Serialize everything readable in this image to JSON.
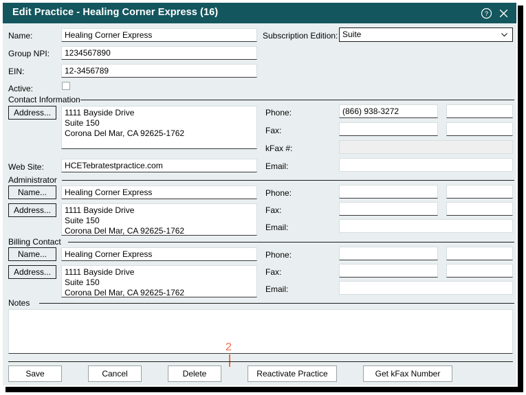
{
  "window": {
    "title": "Edit Practice - Healing Corner Express (16)",
    "help_icon": "help-circle-icon",
    "close_icon": "close-icon",
    "titlebar_color": "#14565e",
    "body_color": "#e9eff0"
  },
  "top": {
    "name_label": "Name:",
    "name_value": "Healing Corner Express",
    "group_npi_label": "Group NPI:",
    "group_npi_value": "1234567890",
    "ein_label": "EIN:",
    "ein_value": "12-3456789",
    "active_label": "Active:",
    "active_checked": false,
    "edition_label": "Subscription Edition:",
    "edition_value": "Suite",
    "edition_caret_icon": "chevron-down-icon"
  },
  "contact": {
    "group_caption": "Contact Information",
    "address_button": "Address...",
    "address_value": "1111 Bayside Drive\nSuite 150\nCorona Del Mar, CA 92625-1762",
    "website_label": "Web Site:",
    "website_value": "HCETebratestpractice.com",
    "phone_label": "Phone:",
    "phone_value": "(866) 938-3272",
    "phone_ext_value": "",
    "fax_label": "Fax:",
    "fax_value": "",
    "fax_ext_value": "",
    "kfax_label": "kFax #:",
    "kfax_value": "",
    "email_label": "Email:",
    "email_value": ""
  },
  "administrator": {
    "group_caption": "Administrator",
    "name_button": "Name...",
    "name_value": "Healing Corner Express",
    "address_button": "Address...",
    "address_value": "1111 Bayside Drive\nSuite 150\nCorona Del Mar, CA 92625-1762",
    "phone_label": "Phone:",
    "phone_value": "",
    "phone_ext_value": "",
    "fax_label": "Fax:",
    "fax_value": "",
    "fax_ext_value": "",
    "email_label": "Email:",
    "email_value": ""
  },
  "billing": {
    "group_caption": "Billing Contact",
    "name_button": "Name...",
    "name_value": "Healing Corner Express",
    "address_button": "Address...",
    "address_value": "1111 Bayside Drive\nSuite 150\nCorona Del Mar, CA 92625-1762",
    "phone_label": "Phone:",
    "phone_value": "",
    "phone_ext_value": "",
    "fax_label": "Fax:",
    "fax_value": "",
    "fax_ext_value": "",
    "email_label": "Email:",
    "email_value": ""
  },
  "notes": {
    "group_caption": "Notes",
    "value": ""
  },
  "footer": {
    "save": "Save",
    "cancel": "Cancel",
    "delete": "Delete",
    "reactivate": "Reactivate Practice",
    "get_kfax": "Get kFax Number"
  },
  "annotation": {
    "number": "2",
    "color": "#f4664a",
    "points_to": "Reactivate Practice"
  }
}
